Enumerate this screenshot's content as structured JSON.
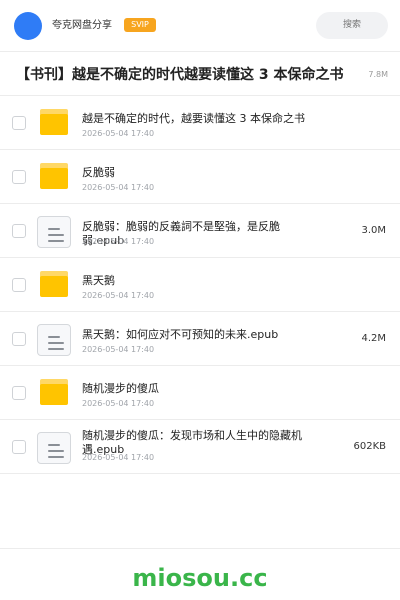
{
  "header": {
    "app_name": "夸克网盘分享",
    "badge": "SVIP",
    "search_placeholder": "搜索"
  },
  "share": {
    "title": "【书刊】越是不确定的时代越要读懂这 3 本保命之书",
    "total_size": "7.8M"
  },
  "files": [
    {
      "type": "folder",
      "name": "越是不确定的时代，越要读懂这 3 本保命之书",
      "date": "2026-05-04 17:40",
      "size": ""
    },
    {
      "type": "folder",
      "name": "反脆弱",
      "date": "2026-05-04 17:40",
      "size": ""
    },
    {
      "type": "file",
      "name": "反脆弱：脆弱的反義詞不是堅強，是反脆弱.epub",
      "date": "2026-05-04 17:40",
      "size": "3.0M"
    },
    {
      "type": "folder",
      "name": "黑天鹅",
      "date": "2026-05-04 17:40",
      "size": ""
    },
    {
      "type": "file",
      "name": "黑天鹅：如何应对不可预知的未来.epub",
      "date": "2026-05-04 17:40",
      "size": "4.2M"
    },
    {
      "type": "folder",
      "name": "随机漫步的傻瓜",
      "date": "2026-05-04 17:40",
      "size": ""
    },
    {
      "type": "file",
      "name": "随机漫步的傻瓜：发现市场和人生中的隐藏机遇.epub",
      "date": "2026-05-04 17:40",
      "size": "602KB"
    }
  ],
  "footer": {
    "watermark": "miosou.cc"
  },
  "colors": {
    "brand_blue": "#2f7cf6",
    "svip_orange": "#f7a51f",
    "folder_yellow": "#ffc400",
    "watermark_green": "#3ab54a"
  }
}
